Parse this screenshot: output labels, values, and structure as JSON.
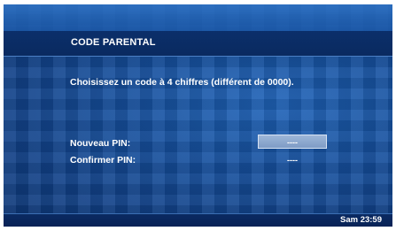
{
  "screen": {
    "title": "CODE PARENTAL",
    "instruction": "Choisissez un code à 4 chiffres (différent de 0000).",
    "new_pin_label": "Nouveau PIN:",
    "confirm_pin_label": "Confirmer PIN:",
    "new_pin_value": "----",
    "confirm_pin_value": "----",
    "clock": "Sam 23:59"
  }
}
